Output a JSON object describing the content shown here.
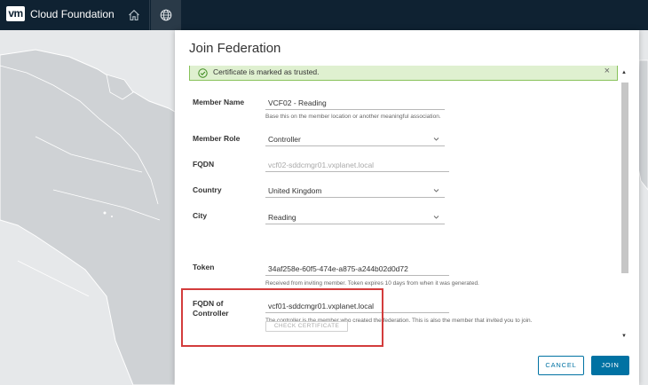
{
  "topbar": {
    "logo_text": "vm",
    "app_title": "Cloud Foundation",
    "nav": [
      {
        "icon": "home-icon"
      },
      {
        "icon": "globe-icon"
      }
    ]
  },
  "modal": {
    "title": "Join Federation",
    "alert": {
      "icon": "check-circle-icon",
      "text": "Certificate is marked as trusted.",
      "close": "×"
    },
    "fields": {
      "member_name": {
        "label": "Member Name",
        "value": "VCF02 - Reading",
        "helper": "Base this on the member location or another meaningful association."
      },
      "member_role": {
        "label": "Member Role",
        "value": "Controller"
      },
      "fqdn": {
        "label": "FQDN",
        "value": "vcf02-sddcmgr01.vxplanet.local"
      },
      "country": {
        "label": "Country",
        "value": "United Kingdom"
      },
      "city": {
        "label": "City",
        "value": "Reading"
      },
      "token": {
        "label": "Token",
        "value": "34af258e-60f5-474e-a875-a244b02d0d72",
        "helper": "Received from inviting member. Token expires 10 days from when it was generated."
      },
      "controller_fqdn": {
        "label_line1": "FQDN of",
        "label_line2": "Controller",
        "value": "vcf01-sddcmgr01.vxplanet.local",
        "helper": "The controller is the member who created the federation. This is also the member that invited you to join."
      }
    },
    "check_certificate_label": "CHECK CERTIFICATE",
    "cancel_label": "CANCEL",
    "join_label": "JOIN"
  },
  "colors": {
    "topbar": "#0f2232",
    "accent": "#0072a3",
    "success": "#88c25a",
    "highlight": "#d33c3c"
  }
}
